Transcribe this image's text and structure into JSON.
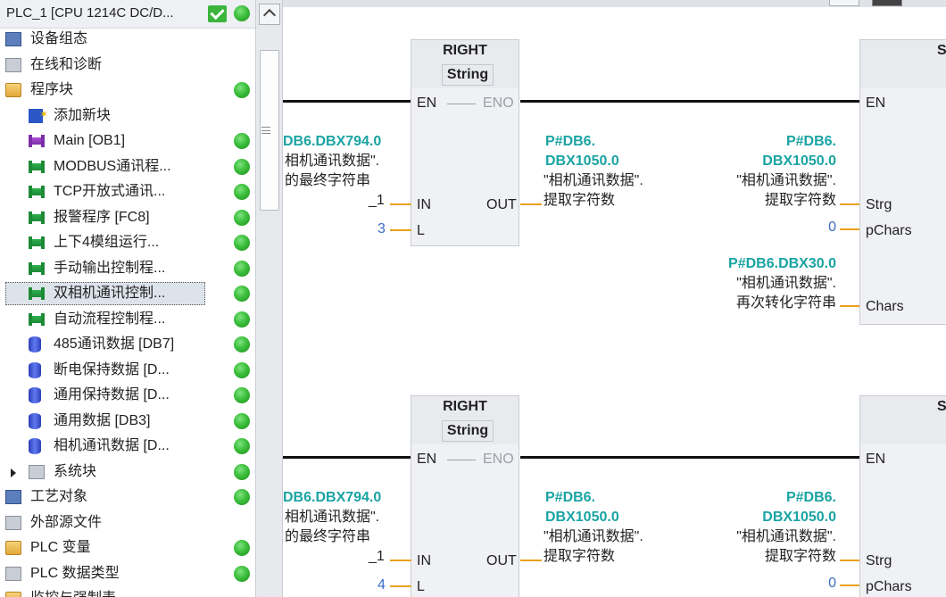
{
  "tree": {
    "header": "PLC_1 [CPU 1214C DC/D...",
    "items": [
      {
        "label": "设备组态",
        "icon": "device-config-icon",
        "status": false
      },
      {
        "label": "在线和诊断",
        "icon": "online-diagnostics-icon",
        "status": false
      },
      {
        "label": "程序块",
        "icon": "folder-icon",
        "status": true
      },
      {
        "label": "添加新块",
        "icon": "add-block-icon",
        "status": false
      },
      {
        "label": "Main [OB1]",
        "icon": "ob-block-icon",
        "status": true
      },
      {
        "label": "MODBUS通讯程...",
        "icon": "fb-block-icon",
        "status": true
      },
      {
        "label": "TCP开放式通讯...",
        "icon": "fb-block-icon",
        "status": true
      },
      {
        "label": "报警程序 [FC8]",
        "icon": "fb-block-icon",
        "status": true
      },
      {
        "label": "上下4模组运行...",
        "icon": "fb-block-icon",
        "status": true
      },
      {
        "label": "手动输出控制程...",
        "icon": "fb-block-icon",
        "status": true
      },
      {
        "label": "双相机通讯控制...",
        "icon": "fb-block-icon",
        "status": true
      },
      {
        "label": "自动流程控制程...",
        "icon": "fb-block-icon",
        "status": true
      },
      {
        "label": "485通讯数据 [DB7]",
        "icon": "db-icon",
        "status": true
      },
      {
        "label": "断电保持数据 [D...",
        "icon": "db-icon",
        "status": true
      },
      {
        "label": "通用保持数据 [D...",
        "icon": "db-icon",
        "status": true
      },
      {
        "label": "通用数据 [DB3]",
        "icon": "db-icon",
        "status": true
      },
      {
        "label": "相机通讯数据 [D...",
        "icon": "db-icon",
        "status": true
      },
      {
        "label": "系统块",
        "icon": "system-blocks-icon",
        "status": true
      },
      {
        "label": "工艺对象",
        "icon": "technology-objects-icon",
        "status": true
      },
      {
        "label": "外部源文件",
        "icon": "external-source-icon",
        "status": false
      },
      {
        "label": "PLC 变量",
        "icon": "plc-tags-icon",
        "status": true
      },
      {
        "label": "PLC 数据类型",
        "icon": "plc-datatype-icon",
        "status": true
      },
      {
        "label": "监控与强制表",
        "icon": "watch-table-icon",
        "status": false
      }
    ]
  },
  "networks": [
    {
      "block_title": "RIGHT",
      "block_type": "String",
      "pins": {
        "en": "EN",
        "eno": "ENO",
        "in": "IN",
        "l": "L",
        "out": "OUT"
      },
      "in_operand": [
        "DB6.DBX794.0",
        "相机通讯数据\".",
        "的最终字符串"
      ],
      "in_symbol": "_1",
      "l_value": "3",
      "out_operand": [
        "P#DB6.",
        "DBX1050.0",
        "\"相机通讯数据\".",
        "提取字符数"
      ],
      "s_block_title": "S",
      "s_pins": {
        "en": "EN",
        "strg": "Strg",
        "pchars": "pChars",
        "chars": "Chars"
      },
      "strg_operand": [
        "P#DB6.",
        "DBX1050.0",
        "\"相机通讯数据\".",
        "提取字符数"
      ],
      "pchars_value": "0",
      "chars_operand": [
        "P#DB6.DBX30.0",
        "\"相机通讯数据\".",
        "再次转化字符串"
      ]
    },
    {
      "block_title": "RIGHT",
      "block_type": "String",
      "pins": {
        "en": "EN",
        "eno": "ENO",
        "in": "IN",
        "l": "L",
        "out": "OUT"
      },
      "in_operand": [
        "DB6.DBX794.0",
        "相机通讯数据\".",
        "的最终字符串"
      ],
      "in_symbol": "_1",
      "l_value": "4",
      "out_operand": [
        "P#DB6.",
        "DBX1050.0",
        "\"相机通讯数据\".",
        "提取字符数"
      ],
      "s_block_title": "S",
      "s_pins": {
        "en": "EN",
        "strg": "Strg",
        "pchars": "pChars"
      },
      "strg_operand": [
        "P#DB6.",
        "DBX1050.0",
        "\"相机通讯数据\".",
        "提取字符数"
      ],
      "pchars_value": "0"
    }
  ]
}
